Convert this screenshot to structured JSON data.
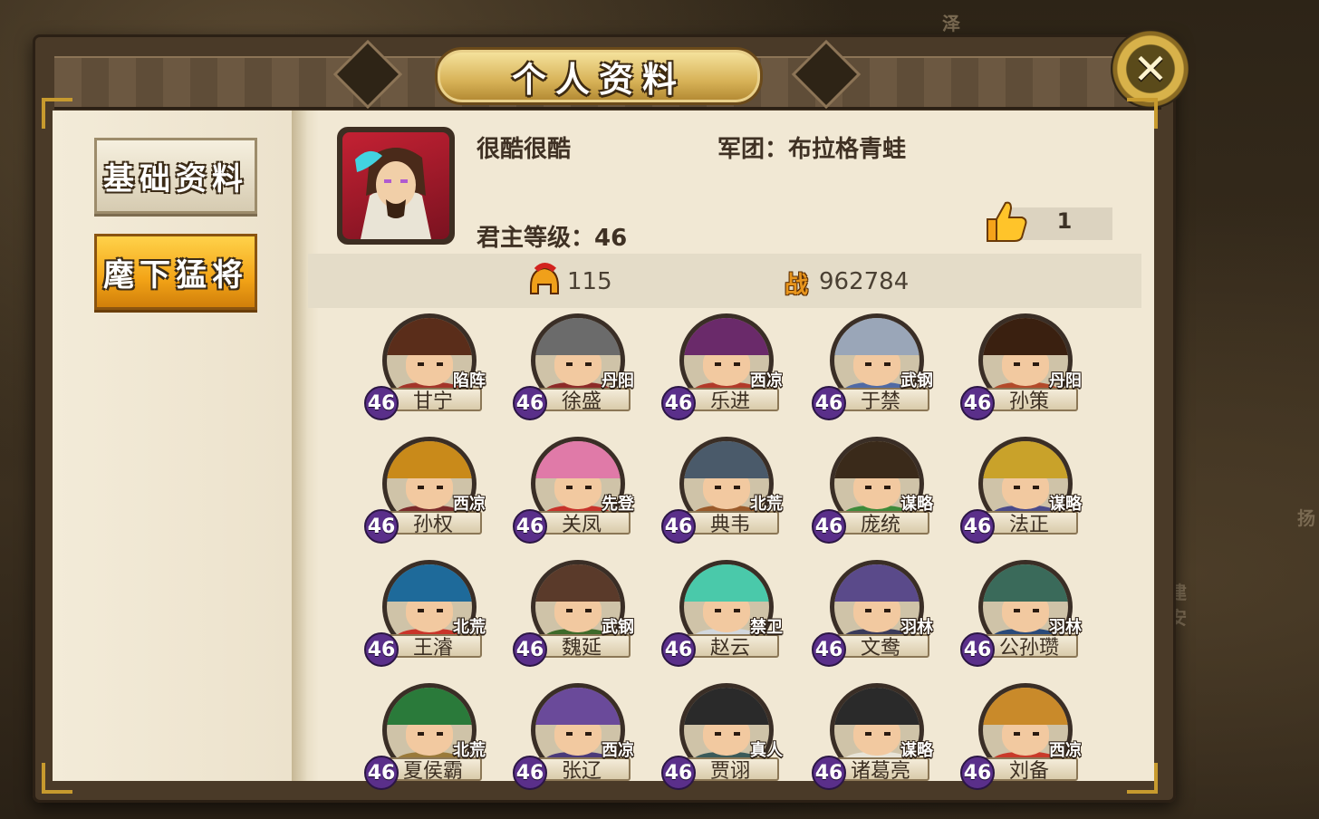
{
  "title": "个人资料",
  "close_symbol": "✕",
  "side_buttons": {
    "basic_info": "基础资料",
    "generals": "麾下猛将"
  },
  "background_labels": [
    "泽",
    "扬",
    "建安"
  ],
  "player": {
    "name": "很酷很酷",
    "legion": "军团：布拉格青蛙",
    "lord_level": "君主等级：46",
    "likes": "1",
    "helmet_count": "115",
    "power_badge": "战",
    "power": "962784"
  },
  "heroes": [
    {
      "name": "甘宁",
      "tag": "陷阵",
      "level": "46",
      "hair": "#5a2d1a",
      "body": "#a4352a"
    },
    {
      "name": "徐盛",
      "tag": "丹阳",
      "level": "46",
      "hair": "#6b6b6b",
      "body": "#8d2a28"
    },
    {
      "name": "乐进",
      "tag": "西凉",
      "level": "46",
      "hair": "#6a2a6a",
      "body": "#b23a2a"
    },
    {
      "name": "于禁",
      "tag": "武钢",
      "level": "46",
      "hair": "#9aa6b8",
      "body": "#4f6aa5"
    },
    {
      "name": "孙策",
      "tag": "丹阳",
      "level": "46",
      "hair": "#3a2010",
      "body": "#b34a2a"
    },
    {
      "name": "孙权",
      "tag": "西凉",
      "level": "46",
      "hair": "#c98a1a",
      "body": "#7a2a2a"
    },
    {
      "name": "关凤",
      "tag": "先登",
      "level": "46",
      "hair": "#e07aa8",
      "body": "#c7332a"
    },
    {
      "name": "典韦",
      "tag": "北荒",
      "level": "46",
      "hair": "#4a5a6a",
      "body": "#9a5a2a"
    },
    {
      "name": "庞统",
      "tag": "谋略",
      "level": "46",
      "hair": "#3a2a1a",
      "body": "#3e8a3a"
    },
    {
      "name": "法正",
      "tag": "谋略",
      "level": "46",
      "hair": "#c9a22a",
      "body": "#4a4a8a"
    },
    {
      "name": "王濬",
      "tag": "北荒",
      "level": "46",
      "hair": "#1e6a9a",
      "body": "#c9352a"
    },
    {
      "name": "魏延",
      "tag": "武钢",
      "level": "46",
      "hair": "#5a3a2a",
      "body": "#3e6a2a"
    },
    {
      "name": "赵云",
      "tag": "禁卫",
      "level": "46",
      "hair": "#4ac9aa",
      "body": "#d3d8dd"
    },
    {
      "name": "文鸯",
      "tag": "羽林",
      "level": "46",
      "hair": "#5a4a8a",
      "body": "#3a3a5a"
    },
    {
      "name": "公孙瓒",
      "tag": "羽林",
      "level": "46",
      "hair": "#3a6a5a",
      "body": "#2a4a7a"
    },
    {
      "name": "夏侯霸",
      "tag": "北荒",
      "level": "46",
      "hair": "#2a7a3a",
      "body": "#9a7a3a"
    },
    {
      "name": "张辽",
      "tag": "西凉",
      "level": "46",
      "hair": "#6a4a9a",
      "body": "#4a3a7a"
    },
    {
      "name": "贾诩",
      "tag": "真人",
      "level": "46",
      "hair": "#2a2a2a",
      "body": "#3a5a5a"
    },
    {
      "name": "诸葛亮",
      "tag": "谋略",
      "level": "46",
      "hair": "#2a2a2a",
      "body": "#e8e4d8"
    },
    {
      "name": "刘备",
      "tag": "西凉",
      "level": "46",
      "hair": "#c98a2a",
      "body": "#c93a2a"
    }
  ]
}
